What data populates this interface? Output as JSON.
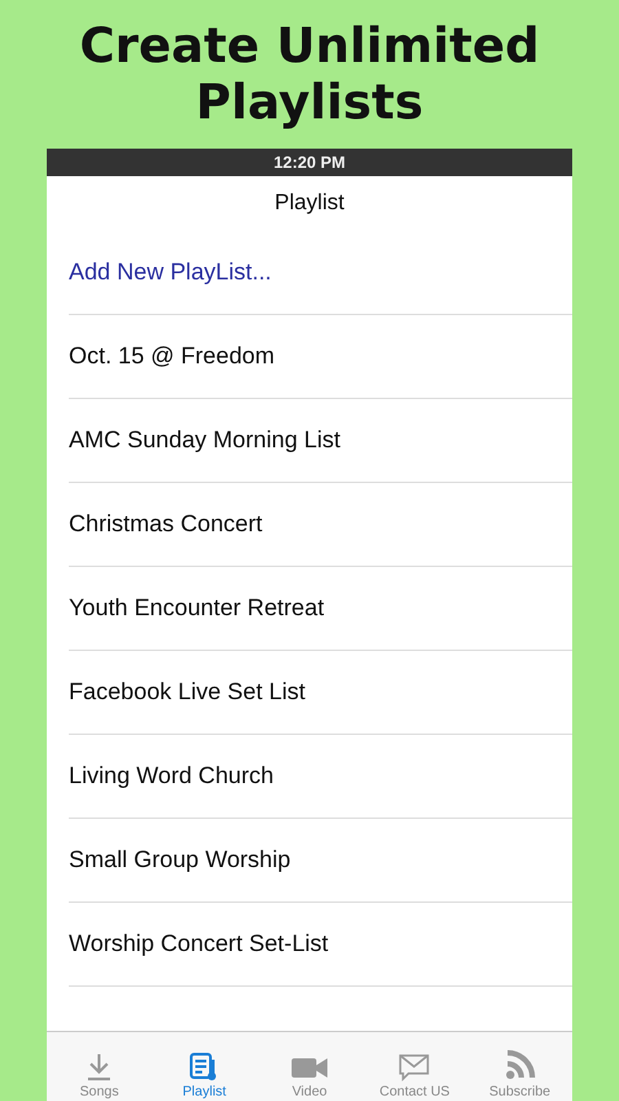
{
  "headline": "Create Unlimited Playlists",
  "status_bar": {
    "time": "12:20 PM"
  },
  "nav": {
    "title": "Playlist"
  },
  "add_action": "Add New PlayList...",
  "playlists": [
    "Oct. 15 @ Freedom",
    "AMC Sunday Morning List",
    "Christmas Concert",
    "Youth Encounter Retreat",
    "Facebook Live Set List",
    "Living Word Church",
    "Small Group Worship",
    "Worship Concert Set-List"
  ],
  "tabs": [
    {
      "label": "Songs",
      "kind": "download",
      "selected": false
    },
    {
      "label": "Playlist",
      "kind": "playlist",
      "selected": true
    },
    {
      "label": "Video",
      "kind": "video",
      "selected": false
    },
    {
      "label": "Contact US",
      "kind": "mail",
      "selected": false
    },
    {
      "label": "Subscribe",
      "kind": "rss",
      "selected": false
    }
  ]
}
